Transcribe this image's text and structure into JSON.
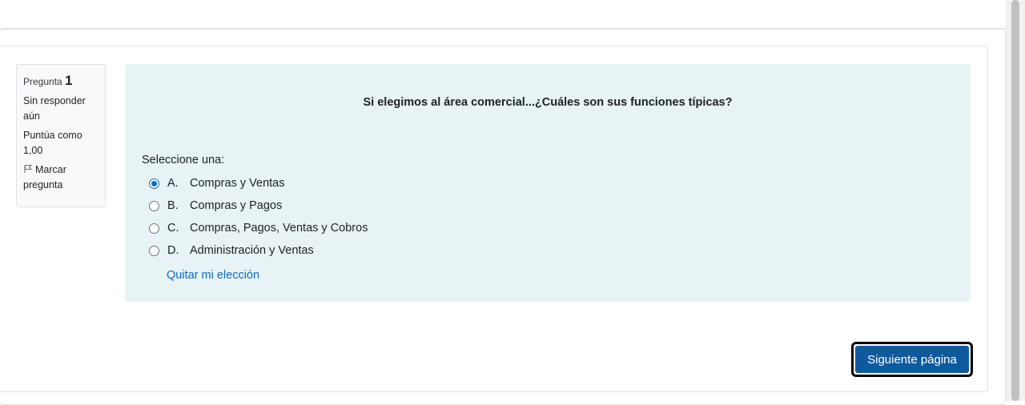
{
  "info": {
    "question_label": "Pregunta",
    "question_number": "1",
    "status": "Sin responder aún",
    "grade": "Puntúa como 1,00",
    "flag_label": "Marcar pregunta"
  },
  "question": {
    "text": "Si elegimos al área comercial...¿Cuáles son sus funciones típicas?",
    "prompt": "Seleccione una:",
    "options": [
      {
        "letter": "A.",
        "text": "Compras y Ventas",
        "selected": true
      },
      {
        "letter": "B.",
        "text": "Compras y Pagos",
        "selected": false
      },
      {
        "letter": "C.",
        "text": "Compras, Pagos, Ventas y Cobros",
        "selected": false
      },
      {
        "letter": "D.",
        "text": "Administración y Ventas",
        "selected": false
      }
    ],
    "clear_label": "Quitar mi elección"
  },
  "navigation": {
    "next_label": "Siguiente página"
  },
  "colors": {
    "accent": "#0f6cbf",
    "content_bg": "#e7f3f5",
    "button_bg": "#0f5a9e"
  }
}
